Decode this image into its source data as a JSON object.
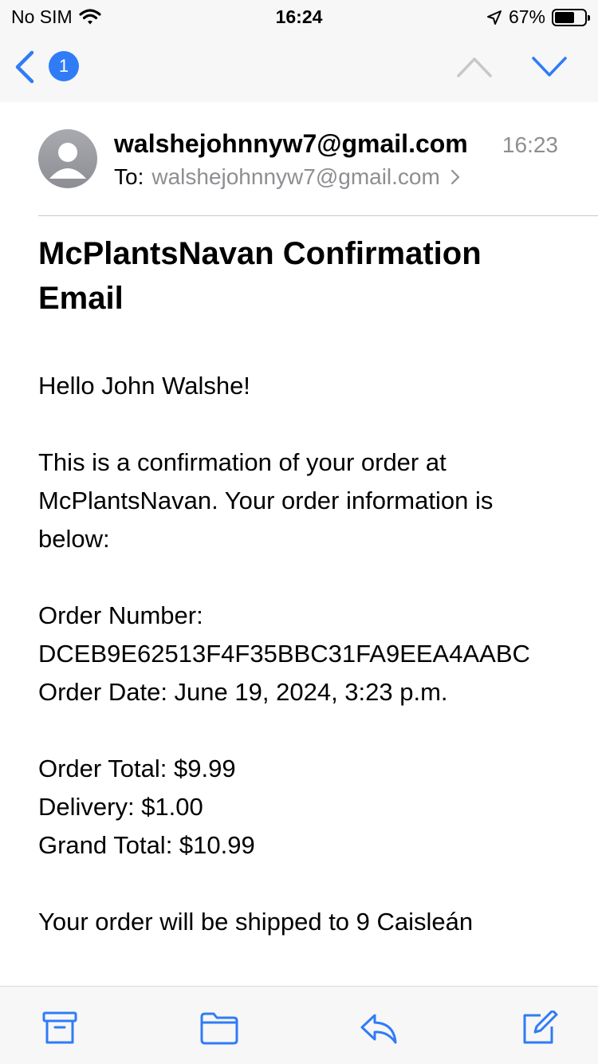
{
  "status_bar": {
    "carrier": "No SIM",
    "time": "16:24",
    "battery_percent": "67%",
    "battery_level": 0.67
  },
  "nav": {
    "unread_count": "1"
  },
  "email": {
    "from": "walshejohnnyw7@gmail.com",
    "time": "16:23",
    "to_label": "To:",
    "to": "walshejohnnyw7@gmail.com",
    "subject": "McPlantsNavan Confirmation Email",
    "greeting": "Hello John  Walshe!",
    "intro": "This is a confirmation of your order at McPlantsNavan. Your order information is below:",
    "order_number_label": "Order Number:",
    "order_number": "DCEB9E62513F4F35BBC31FA9EEA4AABC",
    "order_date": "Order Date: June 19, 2024, 3:23 p.m.",
    "order_total": "Order Total: $9.99",
    "delivery": "Delivery: $1.00",
    "grand_total": "Grand Total: $10.99",
    "shipping": "Your order will be shipped to 9 Caisleán"
  },
  "colors": {
    "accent": "#2f7cf6",
    "secondary_text": "#8e8e93"
  },
  "icons": {
    "back": "chevron-left-icon",
    "up": "chevron-up-icon",
    "down": "chevron-down-icon",
    "archive": "archive-icon",
    "folder": "folder-icon",
    "reply": "reply-icon",
    "compose": "compose-icon"
  }
}
